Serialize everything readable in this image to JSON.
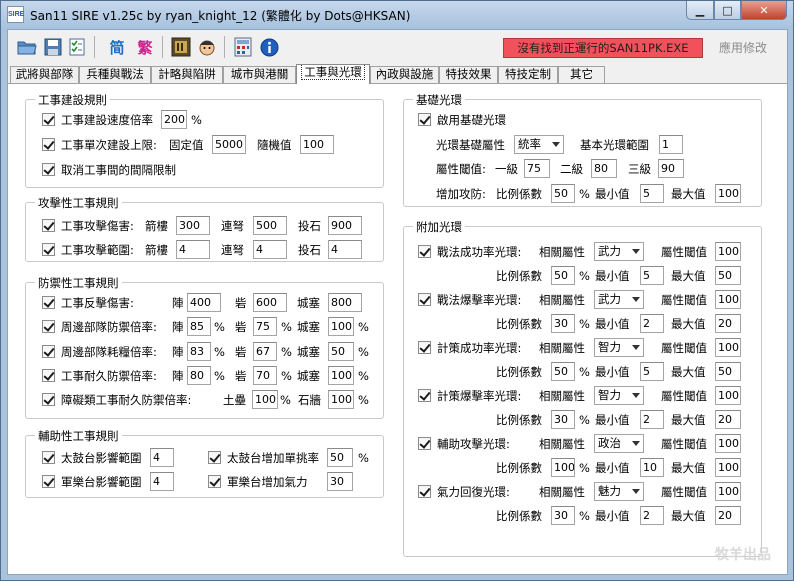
{
  "window": {
    "title": "San11 SIRE v1.25c by ryan_knight_12 (繁體化 by Dots@HKSAN)",
    "icon_text": "SIRE",
    "min_label": "▁",
    "max_label": "□",
    "close_label": "✕"
  },
  "toolbar": {
    "simplified_label": "简",
    "traditional_label": "繁",
    "status_text": "沒有找到正運行的SAN11PK.EXE",
    "apply_label": "應用修改"
  },
  "tabs": [
    {
      "label": "武將與部隊"
    },
    {
      "label": "兵種與戰法"
    },
    {
      "label": "計略與陷阱"
    },
    {
      "label": "城市與港關"
    },
    {
      "label": "工事與光環"
    },
    {
      "label": "內政與設施"
    },
    {
      "label": "特技效果"
    },
    {
      "label": "特技定制"
    },
    {
      "label": "其它"
    }
  ],
  "construction": {
    "title": "工事建設規則",
    "speed_label": "工事建設速度倍率",
    "speed_value": "200",
    "speed_unit": "%",
    "limit_label": "工事單次建設上限:",
    "fixed_label": "固定值",
    "fixed_value": "5000",
    "random_label": "隨機值",
    "random_value": "100",
    "remove_label": "取消工事間的間隔限制"
  },
  "offensive": {
    "title": "攻擊性工事規則",
    "damage_label": "工事攻擊傷害:",
    "range_label": "工事攻擊範圍:",
    "arrow_label": "箭樓",
    "crossbow_label": "連弩",
    "catapult_label": "投石",
    "damage": [
      "300",
      "500",
      "900"
    ],
    "range": [
      "4",
      "4",
      "4"
    ]
  },
  "defensive": {
    "title": "防禦性工事規則",
    "rows": [
      {
        "label": "工事反擊傷害:",
        "a": "陣",
        "av": "400",
        "b": "砦",
        "bv": "600",
        "c": "城塞",
        "cv": "800",
        "unit": ""
      },
      {
        "label": "周邊部隊防禦倍率:",
        "a": "陣",
        "av": "85",
        "b": "砦",
        "bv": "75",
        "c": "城塞",
        "cv": "100",
        "unit": "%"
      },
      {
        "label": "周邊部隊耗糧倍率:",
        "a": "陣",
        "av": "83",
        "b": "砦",
        "bv": "67",
        "c": "城塞",
        "cv": "50",
        "unit": "%"
      },
      {
        "label": "工事耐久防禦倍率:",
        "a": "陣",
        "av": "80",
        "b": "砦",
        "bv": "70",
        "c": "城塞",
        "cv": "100",
        "unit": "%"
      }
    ],
    "obstacle_label": "障礙類工事耐久防禦倍率:",
    "mound_label": "土壘",
    "mound_value": "100",
    "stonewall_label": "石牆",
    "stonewall_value": "100",
    "unit": "%"
  },
  "auxiliary": {
    "title": "輔助性工事規則",
    "drum_range_label": "太鼓台影響範圍",
    "drum_range_value": "4",
    "drum_duel_label": "太鼓台增加單挑率",
    "drum_duel_value": "50",
    "drum_unit": "%",
    "band_range_label": "軍樂台影響範圍",
    "band_range_value": "4",
    "band_morale_label": "軍樂台增加氣力",
    "band_morale_value": "30"
  },
  "basic_aura": {
    "title": "基礎光環",
    "enable_label": "啟用基礎光環",
    "attr_label": "光環基礎屬性",
    "attr_value": "統率",
    "range_label": "基本光環範圍",
    "range_value": "1",
    "threshold_label": "屬性閾值:",
    "lv1_label": "一級",
    "lv1_value": "75",
    "lv2_label": "二級",
    "lv2_value": "80",
    "lv3_label": "三級",
    "lv3_value": "90",
    "boost_label": "增加攻防:",
    "ratio_label": "比例係數",
    "ratio_value": "50",
    "unit": "%",
    "min_label": "最小值",
    "min_value": "5",
    "max_label": "最大值",
    "max_value": "100"
  },
  "extra_aura": {
    "title": "附加光環",
    "related_label": "相關屬性",
    "threshold_label": "屬性閾值",
    "ratio_label": "比例係數",
    "unit": "%",
    "min_label": "最小值",
    "max_label": "最大值",
    "items": [
      {
        "label": "戰法成功率光環:",
        "attr": "武力",
        "threshold": "100",
        "ratio": "50",
        "min": "5",
        "max": "50"
      },
      {
        "label": "戰法爆擊率光環:",
        "attr": "武力",
        "threshold": "100",
        "ratio": "30",
        "min": "2",
        "max": "20"
      },
      {
        "label": "計策成功率光環:",
        "attr": "智力",
        "threshold": "100",
        "ratio": "50",
        "min": "5",
        "max": "50"
      },
      {
        "label": "計策爆擊率光環:",
        "attr": "智力",
        "threshold": "100",
        "ratio": "30",
        "min": "2",
        "max": "20"
      },
      {
        "label": "輔助攻擊光環:",
        "attr": "政治",
        "threshold": "100",
        "ratio": "100",
        "min": "10",
        "max": "100"
      },
      {
        "label": "氣力回復光環:",
        "attr": "魅力",
        "threshold": "100",
        "ratio": "30",
        "min": "2",
        "max": "20"
      }
    ]
  },
  "watermark": "牧羊出品"
}
